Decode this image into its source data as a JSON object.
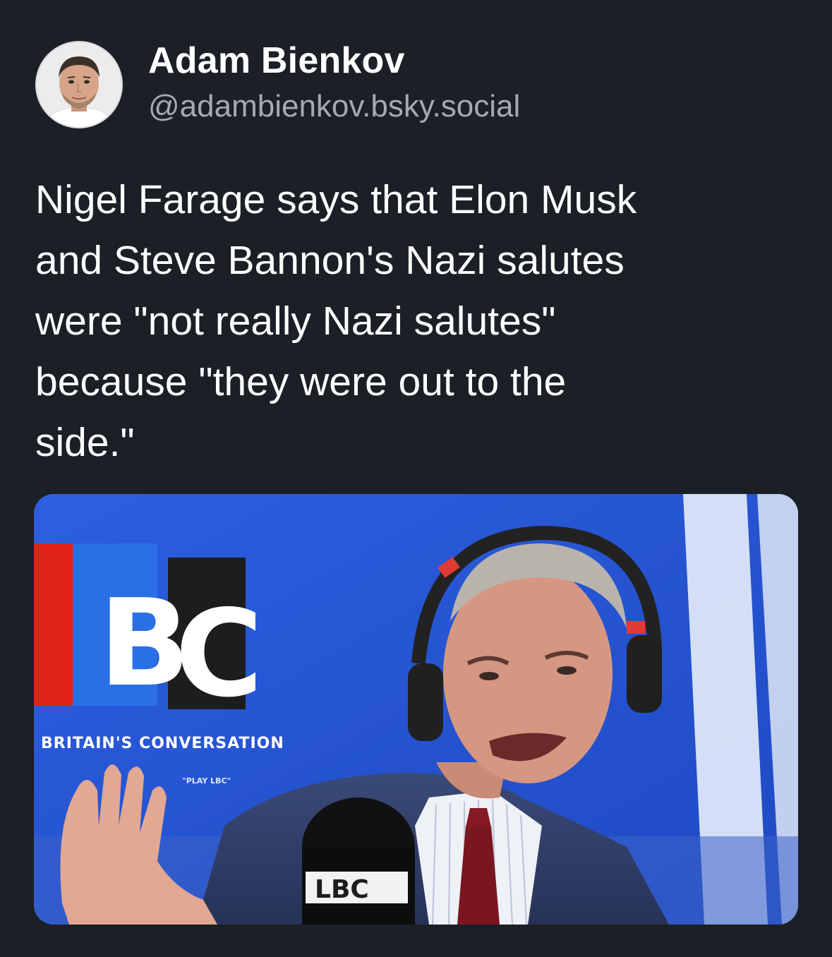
{
  "post": {
    "author": {
      "display_name": "Adam Bienkov",
      "handle": "@adambienkov.bsky.social",
      "avatar_icon": "avatar-photo-icon"
    },
    "text": "Nigel Farage says that Elon Musk\nand Steve Bannon's Nazi salutes\nwere \"not really Nazi salutes\"\nbecause \"they were out to the\nside.\""
  },
  "media": {
    "logo_letters": [
      "B",
      "C"
    ],
    "tagline": "BRITAIN'S CONVERSATION",
    "app_text": "\"PLAY LBC\"",
    "mic_logo": "LBC",
    "colors": {
      "studio_blue": "#2a5bd8",
      "logo_red": "#e2231a",
      "logo_dark": "#1d1d1d"
    }
  },
  "theme": {
    "background": "#1b1f26",
    "text_primary": "#ffffff",
    "text_secondary": "#a3aab6"
  }
}
